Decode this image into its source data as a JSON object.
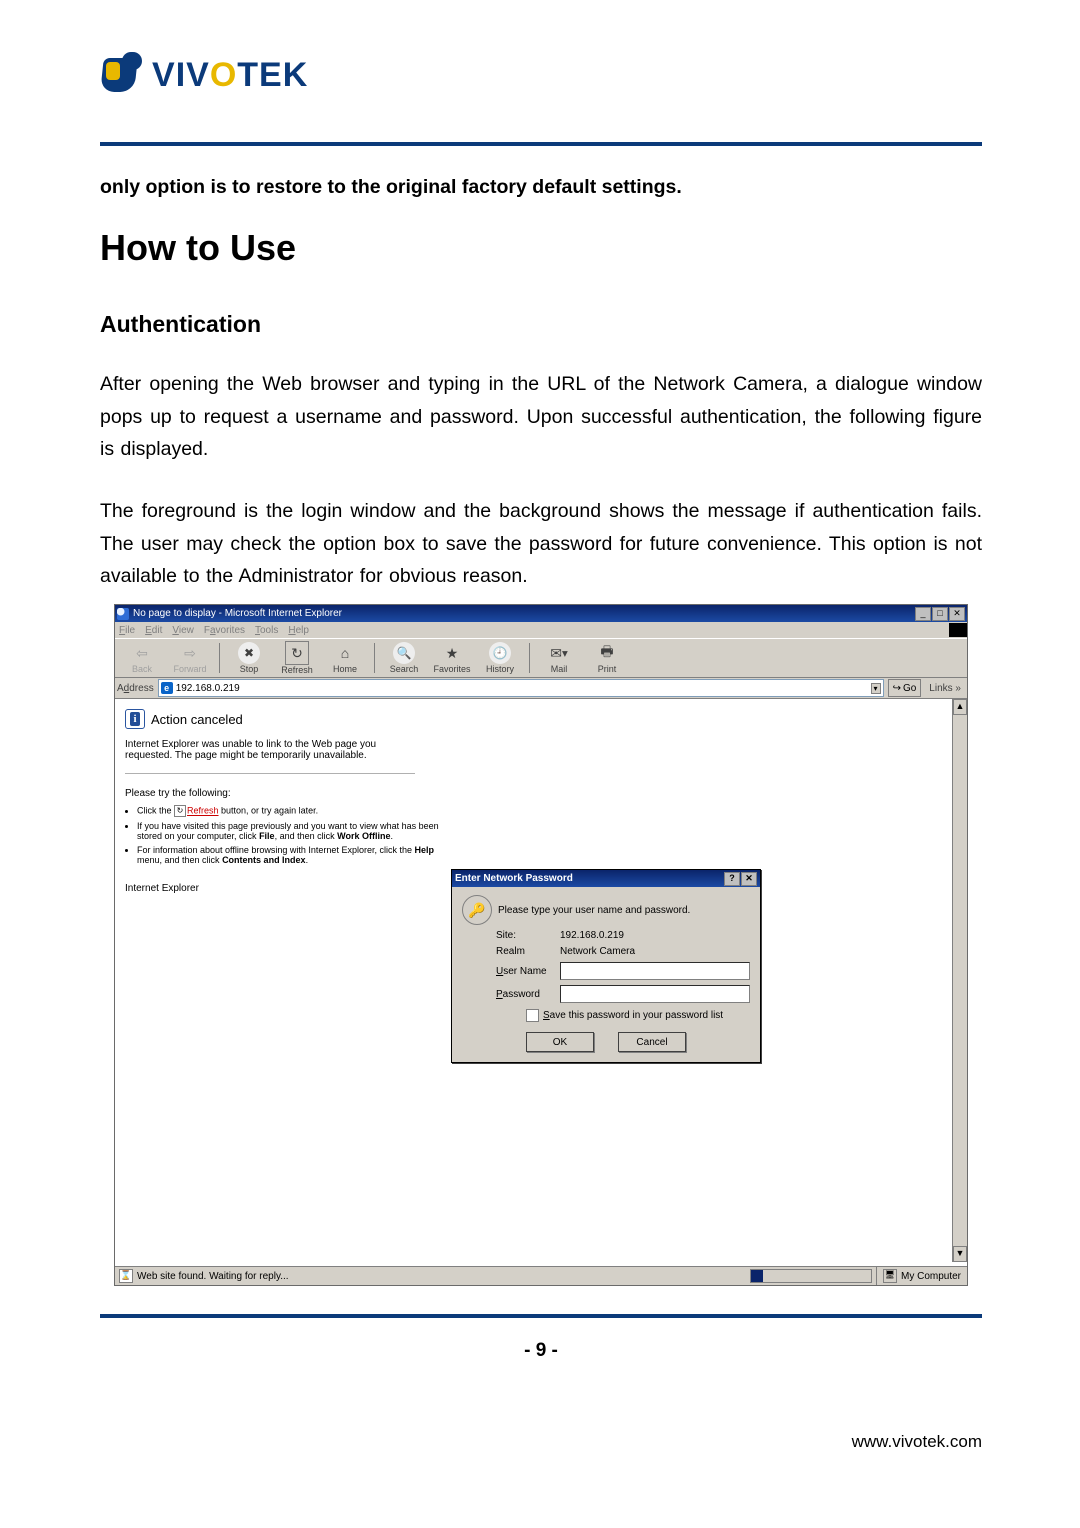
{
  "brand": {
    "name_a": "V",
    "name_b": "IV",
    "name_c": "TEK",
    "o": "O"
  },
  "lead": "only option is to restore to the original factory default settings.",
  "h2": "How to Use",
  "h3": "Authentication",
  "p1": "After opening the Web browser and typing in the URL of the Network Camera, a dialogue window pops up to request a username and password. Upon successful authentication, the following figure is displayed.",
  "p2": "The foreground is the login window and the background shows the message if authentication fails. The user may check the option box to save the password for future convenience.  This option is not available to the Administrator for obvious reason.",
  "ie": {
    "title": "No page to display - Microsoft Internet Explorer",
    "menus": [
      "File",
      "Edit",
      "View",
      "Favorites",
      "Tools",
      "Help"
    ],
    "tb": {
      "back": "Back",
      "forward": "Forward",
      "stop": "Stop",
      "refresh": "Refresh",
      "home": "Home",
      "search": "Search",
      "favorites": "Favorites",
      "history": "History",
      "mail": "Mail",
      "print": "Print"
    },
    "address_label": "Address",
    "address_value": "192.168.0.219",
    "go": "Go",
    "links": "Links",
    "page": {
      "heading": "Action canceled",
      "desc": "Internet Explorer was unable to link to the Web page you requested. The page might be temporarily unavailable.",
      "try_heading": "Please try the following:",
      "bullet1_a": "Click the ",
      "bullet1_link": "Refresh",
      "bullet1_b": " button, or try again later.",
      "bullet2_a": "If you have visited this page previously and you want to view what has been stored on your computer, click ",
      "bullet2_b": "File",
      "bullet2_c": ", and then click ",
      "bullet2_d": "Work Offline",
      "bullet2_e": ".",
      "bullet3_a": "For information about offline browsing with Internet Explorer, click the ",
      "bullet3_b": "Help",
      "bullet3_c": " menu, and then click ",
      "bullet3_d": "Contents and Index",
      "bullet3_e": ".",
      "ie_line": "Internet Explorer"
    },
    "status": "Web site found. Waiting for reply...",
    "zone": "My Computer"
  },
  "dlg": {
    "title": "Enter Network Password",
    "msg": "Please type your user name and password.",
    "site_lbl": "Site:",
    "site_val": "192.168.0.219",
    "realm_lbl": "Realm",
    "realm_val": "Network Camera",
    "user_lbl": "User Name",
    "pass_lbl": "Password",
    "save": "Save this password in your password list",
    "ok": "OK",
    "cancel": "Cancel",
    "help": "?",
    "close": "✕"
  },
  "wctrl": {
    "min": "_",
    "max": "□",
    "close": "✕",
    "up": "▲",
    "down": "▼"
  },
  "page_number": "- 9 -",
  "footer": "www.vivotek.com"
}
